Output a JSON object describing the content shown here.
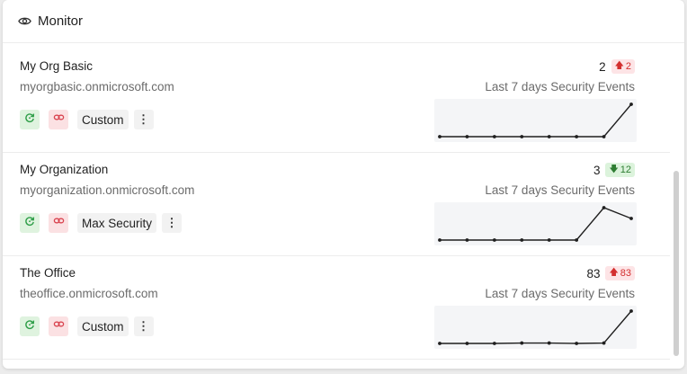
{
  "header": {
    "title": "Monitor",
    "icon": "eye-icon"
  },
  "colors": {
    "sync_bg": "#dff3df",
    "sync_fg": "#2e9e48",
    "link_bg": "#fbe1e3",
    "link_fg": "#d9434f",
    "up_fg": "#d32f2f",
    "down_fg": "#2e7d32",
    "line": "#1f1f1f"
  },
  "tenants": [
    {
      "name": "My Org Basic",
      "domain": "myorgbasic.onmicrosoft.com",
      "policy": "Custom",
      "count": "2",
      "change": "2",
      "direction": "up",
      "label": "Last 7 days Security Events",
      "series": [
        0,
        0,
        0,
        0,
        0,
        0,
        0,
        2
      ]
    },
    {
      "name": "My Organization",
      "domain": "myorganization.onmicrosoft.com",
      "policy": "Max Security",
      "count": "3",
      "change": "12",
      "direction": "down",
      "label": "Last 7 days Security Events",
      "series": [
        0,
        0,
        0,
        0,
        0,
        0,
        3,
        2
      ]
    },
    {
      "name": "The Office",
      "domain": "theoffice.onmicrosoft.com",
      "policy": "Custom",
      "count": "83",
      "change": "83",
      "direction": "up",
      "label": "Last 7 days Security Events",
      "series": [
        0,
        0,
        0,
        1,
        1,
        0,
        1,
        83
      ]
    }
  ]
}
